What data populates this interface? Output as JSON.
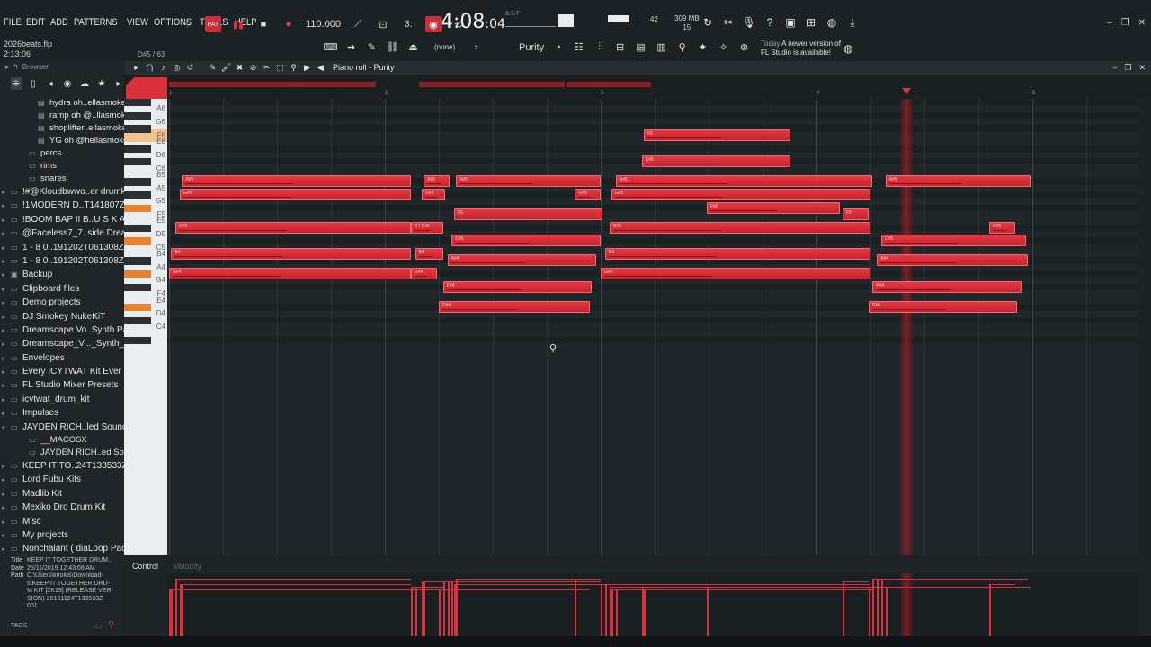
{
  "menu": [
    "FILE",
    "EDIT",
    "ADD",
    "PATTERNS",
    "VIEW",
    "OPTIONS",
    "TOOLS",
    "HELP"
  ],
  "project": {
    "file": "2026beats.flp",
    "time": "2:13:06"
  },
  "hint": "D#5 / 63",
  "transport": {
    "pat": "PAT",
    "tempo": "110.000",
    "clock_main": "4:08",
    "clock_sub": "04",
    "clock_label": "B:S:T",
    "mem": "309 MB",
    "mem_sub": "15",
    "cpu": "42"
  },
  "toolbar": {
    "none_label": "(none)",
    "pattern": "Purity"
  },
  "news": {
    "when": "Today",
    "text1": "A newer version of",
    "text2": "FL Studio is available!"
  },
  "browser": {
    "title": "Browser",
    "items": [
      {
        "label": "hydra oh..ellasmokee",
        "level": 2,
        "type": "file"
      },
      {
        "label": "ramp oh @..llasmokee",
        "level": 2,
        "type": "file"
      },
      {
        "label": "shoplifter..ellasmokee",
        "level": 2,
        "type": "file"
      },
      {
        "label": "YG oh @hellasmokee",
        "level": 2,
        "type": "file"
      },
      {
        "label": "percs",
        "level": 1,
        "type": "folder"
      },
      {
        "label": "rims",
        "level": 1,
        "type": "folder"
      },
      {
        "label": "snares",
        "level": 1,
        "type": "folder"
      },
      {
        "label": "!#@Kloudbwwo..er drumkit !",
        "level": 0,
        "type": "folder"
      },
      {
        "label": "!1MODERN D..T141807Z-001",
        "level": 0,
        "type": "folder"
      },
      {
        "label": "!BOOM BAP II B..U S K A N A",
        "level": 0,
        "type": "folder"
      },
      {
        "label": "@Faceless7_7..side Dreamin'",
        "level": 0,
        "type": "folder"
      },
      {
        "label": "1 - 8 0..191202T061308Z-001",
        "level": 0,
        "type": "folder"
      },
      {
        "label": "1 - 8 0..191202T061308Z-001",
        "level": 0,
        "type": "folder"
      },
      {
        "label": "Backup",
        "level": 0,
        "type": "special"
      },
      {
        "label": "Clipboard files",
        "level": 0,
        "type": "folder"
      },
      {
        "label": "Demo projects",
        "level": 0,
        "type": "folder"
      },
      {
        "label": "DJ Smokey NukeKiT",
        "level": 0,
        "type": "folder"
      },
      {
        "label": "Dreamscape Vo..Synth Pack]",
        "level": 0,
        "type": "folder"
      },
      {
        "label": "Dreamscape_V..._Synth_Pack",
        "level": 0,
        "type": "folder"
      },
      {
        "label": "Envelopes",
        "level": 0,
        "type": "folder"
      },
      {
        "label": "Every ICYTWAT Kit Ever",
        "level": 0,
        "type": "folder"
      },
      {
        "label": "FL Studio Mixer Presets",
        "level": 0,
        "type": "folder"
      },
      {
        "label": "icytwat_drum_kit",
        "level": 0,
        "type": "folder"
      },
      {
        "label": "Impulses",
        "level": 0,
        "type": "folder"
      },
      {
        "label": "JAYDEN RICH..led Sound Kit",
        "level": 0,
        "type": "folder-open"
      },
      {
        "label": "__MACOSX",
        "level": 1,
        "type": "folder"
      },
      {
        "label": "JAYDEN RICH..ed Sound Kit",
        "level": 1,
        "type": "folder"
      },
      {
        "label": "KEEP IT TO..24T133533Z-001",
        "level": 0,
        "type": "folder"
      },
      {
        "label": "Lord Fubu Kits",
        "level": 0,
        "type": "folder"
      },
      {
        "label": "Madlib Kit",
        "level": 0,
        "type": "folder"
      },
      {
        "label": "Mexiko Dro Drum Kit",
        "level": 0,
        "type": "folder"
      },
      {
        "label": "Misc",
        "level": 0,
        "type": "folder"
      },
      {
        "label": "My projects",
        "level": 0,
        "type": "folder"
      },
      {
        "label": "Nonchalant ( diaLoop Pack)",
        "level": 0,
        "type": "folder"
      }
    ],
    "info": {
      "title_k": "Title",
      "title_v": "KEEP IT TOGETHER DRUM..",
      "date_k": "Date",
      "date_v": "25/11/2019 12:43:08 AM",
      "path_k": "Path",
      "path_v1": "C:\\Users\\kirolus\\Download-",
      "path_v2": "s\\KEEP IT TOGETHER DRU-",
      "path_v3": "M KIT [2K19] (RELEASE VER-",
      "path_v4": "SION)-20191124T133533Z-",
      "path_v5": "001"
    },
    "tags": "TAGS"
  },
  "pianoroll": {
    "title": "Piano roll - Purity",
    "control": "Control",
    "control_sel": "Velocity",
    "bars": [
      "1",
      "2",
      "3",
      "4",
      "5"
    ],
    "keys": [
      "A6",
      "G6",
      "F6",
      "E6",
      "D6",
      "C6",
      "B5",
      "A5",
      "G5",
      "F5",
      "E5",
      "D5",
      "C5",
      "B4",
      "A4",
      "G4",
      "F4",
      "E4",
      "D4",
      "C4"
    ],
    "notes": [
      {
        "pitch": "F6",
        "label": "F6",
        "start": 3.2,
        "len": 0.68
      },
      {
        "pitch": "C#6",
        "label": "C#6",
        "start": 3.19,
        "len": 0.69
      },
      {
        "pitch": "A#5",
        "label": "A#5",
        "start": 1.06,
        "len": 1.06
      },
      {
        "pitch": "A#5",
        "label": "A#5",
        "start": 2.18,
        "len": 0.12
      },
      {
        "pitch": "A#5",
        "label": "A#5",
        "start": 2.33,
        "len": 0.67
      },
      {
        "pitch": "A#5",
        "label": "A#5",
        "start": 3.07,
        "len": 1.19
      },
      {
        "pitch": "A#5",
        "label": "A#5",
        "start": 4.32,
        "len": 0.67
      },
      {
        "pitch": "G#5",
        "label": "G#5",
        "start": 1.05,
        "len": 1.07
      },
      {
        "pitch": "G#5",
        "label": "G#5",
        "start": 2.17,
        "len": 0.11
      },
      {
        "pitch": "G#5",
        "label": "G#5",
        "start": 2.88,
        "len": 0.12
      },
      {
        "pitch": "G#5",
        "label": "G#5",
        "start": 3.05,
        "len": 1.2
      },
      {
        "pitch": "F#5",
        "label": "F#5",
        "start": 3.49,
        "len": 0.62
      },
      {
        "pitch": "F5",
        "label": "F5",
        "start": 2.32,
        "len": 0.69
      },
      {
        "pitch": "F5",
        "label": "F5",
        "start": 4.12,
        "len": 0.12
      },
      {
        "pitch": "D#5",
        "label": "D#5",
        "start": 1.03,
        "len": 1.09
      },
      {
        "pitch": "D#5",
        "label": "D I D#5",
        "start": 2.12,
        "len": 0.15
      },
      {
        "pitch": "D#5",
        "label": "D#5",
        "start": 3.04,
        "len": 1.21
      },
      {
        "pitch": "D#5",
        "label": "D#5",
        "start": 4.8,
        "len": 0.12
      },
      {
        "pitch": "C#5",
        "label": "C#5",
        "start": 2.31,
        "len": 0.69
      },
      {
        "pitch": "C#5",
        "label": "C#5",
        "start": 4.3,
        "len": 0.67
      },
      {
        "pitch": "B4",
        "label": "B4",
        "start": 1.01,
        "len": 1.11
      },
      {
        "pitch": "B4",
        "label": "B4",
        "start": 2.14,
        "len": 0.13
      },
      {
        "pitch": "B4",
        "label": "B4",
        "start": 3.02,
        "len": 1.23
      },
      {
        "pitch": "A#4",
        "label": "A#4",
        "start": 2.29,
        "len": 0.69
      },
      {
        "pitch": "A#4",
        "label": "A#4",
        "start": 4.28,
        "len": 0.7
      },
      {
        "pitch": "G#4",
        "label": "G#4",
        "start": 1.0,
        "len": 1.12
      },
      {
        "pitch": "G#4",
        "label": "G#4",
        "start": 2.12,
        "len": 0.12
      },
      {
        "pitch": "G#4",
        "label": "G#4",
        "start": 3.0,
        "len": 1.25
      },
      {
        "pitch": "F#4",
        "label": "F#4",
        "start": 2.27,
        "len": 0.69
      },
      {
        "pitch": "F#4",
        "label": "F#4",
        "start": 4.26,
        "len": 0.69
      },
      {
        "pitch": "D#4",
        "label": "D#4",
        "start": 2.25,
        "len": 0.7
      },
      {
        "pitch": "D#4",
        "label": "D#4",
        "start": 4.24,
        "len": 0.69
      }
    ]
  },
  "colors": {
    "note": "#d8303a",
    "accent": "#e23a44",
    "bg": "#202629"
  }
}
